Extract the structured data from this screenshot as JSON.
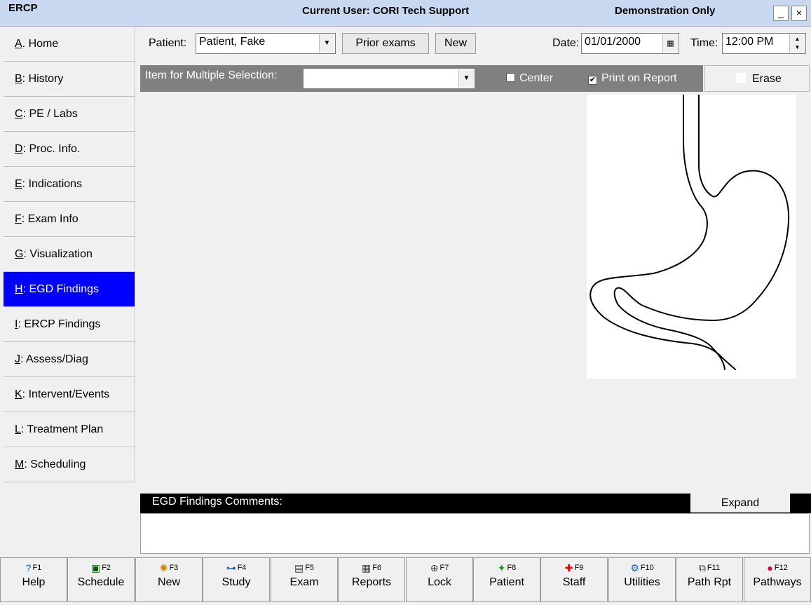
{
  "window": {
    "app_name": "ERCP",
    "current_user": "Current User: CORI Tech Support",
    "mode": "Demonstration Only",
    "minimize_label": "_",
    "close_label": "×"
  },
  "sidebar": {
    "items": [
      {
        "key": "A",
        "label": ". Home"
      },
      {
        "key": "B",
        "label": ": History"
      },
      {
        "key": "C",
        "label": ": PE / Labs"
      },
      {
        "key": "D",
        "label": ": Proc. Info."
      },
      {
        "key": "E",
        "label": ": Indications"
      },
      {
        "key": "F",
        "label": ": Exam Info"
      },
      {
        "key": "G",
        "label": ": Visualization"
      },
      {
        "key": "H",
        "label": ": EGD Findings"
      },
      {
        "key": "I",
        "label": ": ERCP Findings"
      },
      {
        "key": "J",
        "label": ": Assess/Diag"
      },
      {
        "key": "K",
        "label": ": Intervent/Events"
      },
      {
        "key": "L",
        "label": ": Treatment Plan"
      },
      {
        "key": "M",
        "label": ": Scheduling"
      }
    ],
    "active_index": 7
  },
  "toolbar": {
    "patient_label": "Patient:",
    "patient_value": "Patient, Fake",
    "prior_exams_label": "Prior exams",
    "new_label": "New",
    "date_label": "Date:",
    "date_value": "01/01/2000",
    "time_label": "Time:",
    "time_value": "12:00 PM"
  },
  "multi_select": {
    "label": "Item for Multiple Selection:",
    "value": "",
    "center_label": "Center",
    "center_checked": false,
    "print_label": "Print on Report",
    "print_checked": true,
    "erase_label": "Erase"
  },
  "comments": {
    "title": "EGD Findings Comments:",
    "expand_label": "Expand",
    "value": ""
  },
  "function_keys": [
    {
      "num": "F1",
      "name": "Help",
      "icon": "help-icon",
      "glyph": "?",
      "color": "#0060c0"
    },
    {
      "num": "F2",
      "name": "Schedule",
      "icon": "calendar-icon",
      "glyph": "▣",
      "color": "#006000"
    },
    {
      "num": "F3",
      "name": "New",
      "icon": "lightbulb-icon",
      "glyph": "✺",
      "color": "#d08000"
    },
    {
      "num": "F4",
      "name": "Study",
      "icon": "network-icon",
      "glyph": "⊶",
      "color": "#0050c0"
    },
    {
      "num": "F5",
      "name": "Exam",
      "icon": "exam-icon",
      "glyph": "▤",
      "color": "#404040"
    },
    {
      "num": "F6",
      "name": "Reports",
      "icon": "reports-icon",
      "glyph": "▦",
      "color": "#404040"
    },
    {
      "num": "F7",
      "name": "Lock",
      "icon": "lock-icon",
      "glyph": "⊕",
      "color": "#404040"
    },
    {
      "num": "F8",
      "name": "Patient",
      "icon": "running-person-icon",
      "glyph": "✦",
      "color": "#00a000"
    },
    {
      "num": "F9",
      "name": "Staff",
      "icon": "red-cross-icon",
      "glyph": "✚",
      "color": "#e00000"
    },
    {
      "num": "F10",
      "name": "Utilities",
      "icon": "tools-icon",
      "glyph": "⚙",
      "color": "#1060d0"
    },
    {
      "num": "F11",
      "name": "Path Rpt",
      "icon": "path-report-icon",
      "glyph": "⧉",
      "color": "#404040"
    },
    {
      "num": "F12",
      "name": "Pathways",
      "icon": "pill-icon",
      "glyph": "●",
      "color": "#e00030"
    }
  ]
}
